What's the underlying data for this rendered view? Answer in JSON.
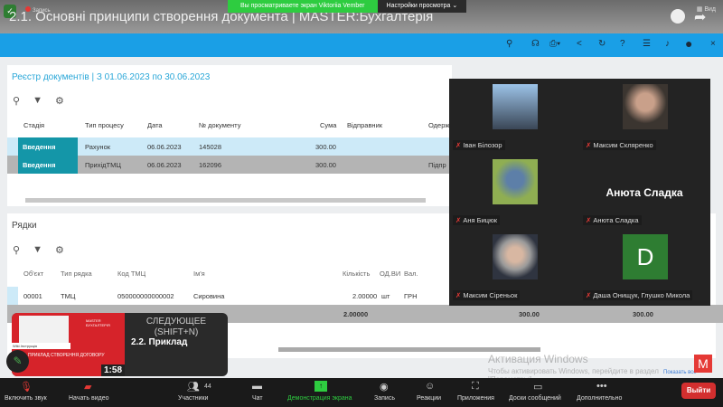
{
  "window": {
    "title": "2.1. Основні принципи створення документа | MASTER:Бухгалтерія",
    "recording": "Запись",
    "view": "Вид"
  },
  "share_banner": {
    "text": "Вы просматриваете экран Viktoriia Vember",
    "settings": "Настройки просмотра"
  },
  "registry": {
    "title": "Реєстр документів | З 01.06.2023 по 30.06.2023",
    "columns": [
      "Стадія",
      "Тип процесу",
      "Дата",
      "№ документу",
      "Сума",
      "Відправник",
      "Одерж"
    ],
    "rows": [
      {
        "stage": "Введення",
        "type": "Рахунок",
        "date": "06.06.2023",
        "number": "145028",
        "sum": "300.00",
        "recipient": ""
      },
      {
        "stage": "Введення",
        "type": "ПрихідТМЦ",
        "date": "06.06.2023",
        "number": "162096",
        "sum": "300.00",
        "recipient": "Підпр"
      }
    ]
  },
  "lines": {
    "title": "Рядки",
    "columns": [
      "Об'єкт",
      "Тип рядка",
      "Код ТМЦ",
      "Ім'я",
      "Кількість",
      "ОД.ВИ",
      "Вал."
    ],
    "rows": [
      {
        "object": "00001",
        "type": "ТМЦ",
        "code": "050000000000002",
        "name": "Сировина",
        "qty": "2.00000",
        "unit": "шт",
        "currency": "ГРН"
      }
    ],
    "totals": {
      "qty": "2.00000",
      "sum1": "300.00",
      "sum2": "300.00"
    }
  },
  "gallery": {
    "participants": [
      {
        "name": "Іван Білозор",
        "photo_color": "#5d7fa8"
      },
      {
        "name": "Максим Скляренко",
        "photo_color": "#3b3530"
      },
      {
        "name": "Аня Бицюк",
        "photo_color": "#8fae52"
      },
      {
        "name": "Анюта Сладка",
        "big_name": "Анюта Сладка"
      },
      {
        "name": "Максим Сіреньок",
        "photo_color": "#8a8a8a"
      },
      {
        "name": "Даша Онищук, Глушко Микола",
        "initial": "D"
      }
    ]
  },
  "next_video": {
    "label": "СЛЕДУЮЩЕЕ",
    "shortcut": "(SHIFT+N)",
    "title": "2.2. Приклад",
    "duration": "1:58",
    "thumb_text": "ПРИКЛАД СТВОРЕННЯ ДОГОВОРУ",
    "thumb_brand": "MASTER БУХГАЛТЕРІЯ",
    "thumb_caption": "Wiki.Інструкція"
  },
  "windows": {
    "title": "Активация Windows",
    "text": "Чтобы активировать Windows, перейдите в раздел \"Параметры\".",
    "show_all": "Показать все"
  },
  "zoom_bar": {
    "unmute": "Включить звук",
    "video": "Начать видео",
    "participants": "Участники",
    "participants_count": "44",
    "chat": "Чат",
    "share": "Демонстрация экрана",
    "record": "Запись",
    "reactions": "Реакции",
    "apps": "Приложения",
    "whiteboards": "Доски сообщений",
    "more": "Дополнительно",
    "leave": "Выйти"
  },
  "colors": {
    "accent": "#1a9fe6",
    "stage": "#1496a8",
    "selected_row": "#cdeaf8",
    "zoom_green": "#2ecc40",
    "leave": "#d32f2f"
  }
}
